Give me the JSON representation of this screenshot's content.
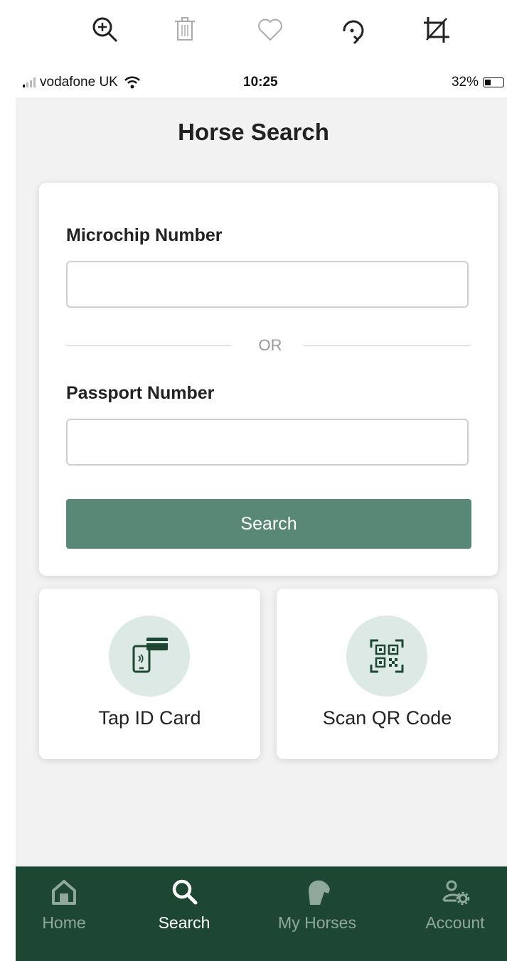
{
  "viewer_toolbar": {
    "icons": [
      "zoom-in-icon",
      "trash-icon",
      "heart-icon",
      "rotate-icon",
      "crop-icon"
    ]
  },
  "status_bar": {
    "carrier": "vodafone UK",
    "time": "10:25",
    "battery": "32%",
    "battery_level": 0.32
  },
  "header": {
    "title": "Horse Search"
  },
  "form": {
    "microchip_label": "Microchip Number",
    "microchip_value": "",
    "divider_text": "OR",
    "passport_label": "Passport Number",
    "passport_value": "",
    "search_label": "Search"
  },
  "actions": {
    "tap_label": "Tap ID Card",
    "scan_label": "Scan QR Code"
  },
  "bottom_nav": {
    "items": [
      {
        "label": "Home",
        "icon": "home-icon",
        "active": false
      },
      {
        "label": "Search",
        "icon": "search-icon",
        "active": true
      },
      {
        "label": "My Horses",
        "icon": "horse-icon",
        "active": false
      },
      {
        "label": "Account",
        "icon": "account-settings-icon",
        "active": false
      }
    ]
  },
  "colors": {
    "brand_green": "#1e4733",
    "button_green": "#5a8877",
    "icon_circle": "#dde9e4"
  }
}
